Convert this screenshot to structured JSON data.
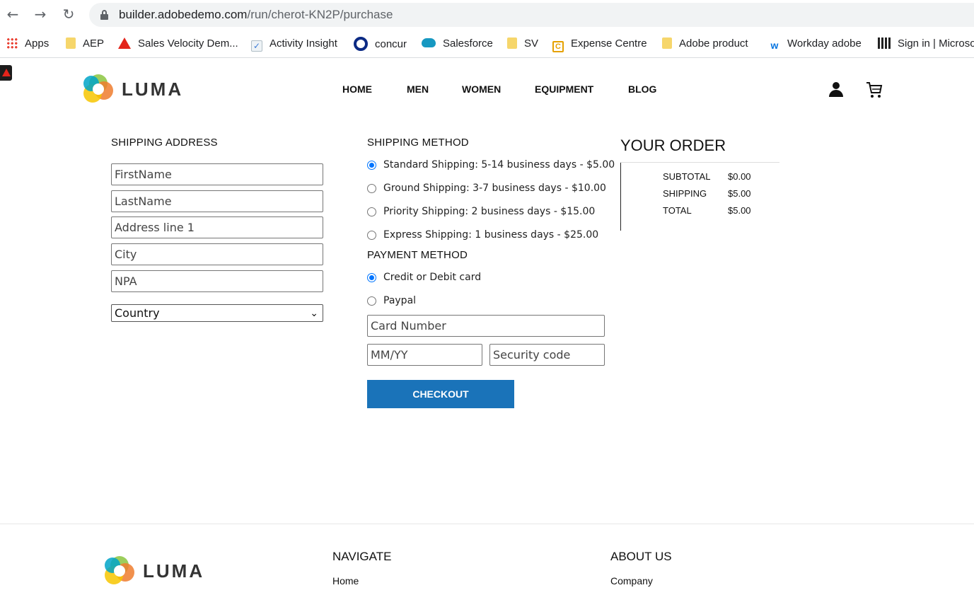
{
  "browser": {
    "url_host": "builder.adobedemo.com",
    "url_path": "/run/cherot-KN2P/purchase",
    "back_icon": "arrow-left",
    "forward_icon": "arrow-right",
    "reload_icon": "reload"
  },
  "bookmarks": [
    {
      "label": "Apps",
      "icon": "apps-grid"
    },
    {
      "label": "AEP",
      "icon": "folder"
    },
    {
      "label": "Sales Velocity Dem...",
      "icon": "adobe"
    },
    {
      "label": "Activity Insight",
      "icon": "checkbox"
    },
    {
      "label": "concur",
      "icon": "ring"
    },
    {
      "label": "Salesforce",
      "icon": "cloud"
    },
    {
      "label": "SV",
      "icon": "folder"
    },
    {
      "label": "Expense Centre",
      "icon": "expense"
    },
    {
      "label": "Adobe product",
      "icon": "folder"
    },
    {
      "label": "Workday adobe",
      "icon": "workday"
    },
    {
      "label": "Sign in | Microso",
      "icon": "bars"
    }
  ],
  "site": {
    "logo_text": "LUMA",
    "nav": [
      "HOME",
      "MEN",
      "WOMEN",
      "EQUIPMENT",
      "BLOG"
    ]
  },
  "shipping_address": {
    "title": "SHIPPING ADDRESS",
    "first_name_placeholder": "FirstName",
    "last_name_placeholder": "LastName",
    "address_placeholder": "Address line 1",
    "city_placeholder": "City",
    "npa_placeholder": "NPA",
    "country_selected": "Country"
  },
  "shipping_method": {
    "title": "SHIPPING METHOD",
    "options": [
      {
        "label": "Standard Shipping: 5-14 business days - $5.00",
        "selected": true
      },
      {
        "label": "Ground Shipping: 3-7 business days - $10.00",
        "selected": false
      },
      {
        "label": "Priority Shipping: 2 business days - $15.00",
        "selected": false
      },
      {
        "label": "Express Shipping: 1 business days - $25.00",
        "selected": false
      }
    ]
  },
  "payment_method": {
    "title": "PAYMENT METHOD",
    "options": [
      {
        "label": "Credit or Debit card",
        "selected": true
      },
      {
        "label": "Paypal",
        "selected": false
      }
    ],
    "card_number_placeholder": "Card Number",
    "expiry_placeholder": "MM/YY",
    "security_placeholder": "Security code",
    "checkout_label": "CHECKOUT"
  },
  "order": {
    "title": "YOUR ORDER",
    "rows": [
      {
        "label": "SUBTOTAL",
        "value": "$0.00"
      },
      {
        "label": "SHIPPING",
        "value": "$5.00"
      },
      {
        "label": "TOTAL",
        "value": "$5.00"
      }
    ]
  },
  "footer": {
    "logo_text": "LUMA",
    "navigate_title": "NAVIGATE",
    "navigate_link": "Home",
    "about_title": "ABOUT US",
    "about_link": "Company"
  },
  "colors": {
    "accent": "#1a73b9",
    "radio_selected": "#0075ff"
  }
}
